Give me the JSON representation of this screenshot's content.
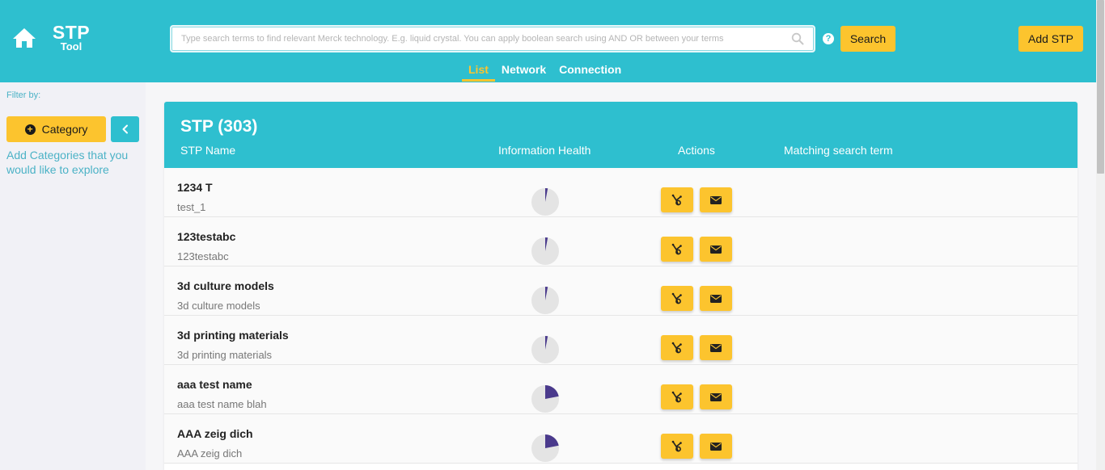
{
  "header": {
    "logo_main": "STP",
    "logo_sub": "Tool",
    "search_placeholder": "Type search terms to find relevant Merck technology. E.g. liquid crystal. You can apply boolean search using AND OR between your terms",
    "help_glyph": "?",
    "search_label": "Search",
    "add_stp_label": "Add STP",
    "tabs": [
      {
        "label": "List",
        "active": true
      },
      {
        "label": "Network",
        "active": false
      },
      {
        "label": "Connection",
        "active": false
      }
    ]
  },
  "sidebar": {
    "filter_label": "Filter by:",
    "category_label": "Category",
    "hint": "Add Categories that you would like to explore"
  },
  "panel": {
    "title": "STP (303)",
    "columns": {
      "name": "STP Name",
      "health": "Information Health",
      "actions": "Actions",
      "match": "Matching search term"
    },
    "rows": [
      {
        "name": "1234 T",
        "sub": "test_1",
        "health": 0.03
      },
      {
        "name": "123testabc",
        "sub": "123testabc",
        "health": 0.03
      },
      {
        "name": "3d culture models",
        "sub": "3d culture models",
        "health": 0.03
      },
      {
        "name": "3d printing materials",
        "sub": "3d printing materials",
        "health": 0.03
      },
      {
        "name": "aaa test name",
        "sub": "aaa test name blah",
        "health": 0.22
      },
      {
        "name": "AAA zeig dich",
        "sub": "AAA zeig dich",
        "health": 0.22
      }
    ]
  },
  "colors": {
    "brand": "#2ebfcf",
    "accent": "#fcc42e",
    "health_fill": "#4a3a8c",
    "health_bg": "#e4e4e4"
  }
}
